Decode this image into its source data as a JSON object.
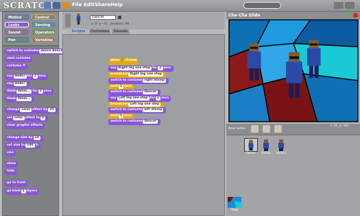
{
  "app": {
    "logo": "SCRATCH",
    "menus": [
      "File",
      "Edit",
      "Share",
      "Help"
    ]
  },
  "categories": [
    {
      "label": "Motion",
      "color": "#4a6cd4"
    },
    {
      "label": "Control",
      "color": "#e1a91a"
    },
    {
      "label": "Looks",
      "color": "#8a55d7"
    },
    {
      "label": "Sensing",
      "color": "#2ca5e2"
    },
    {
      "label": "Sound",
      "color": "#bb42c3"
    },
    {
      "label": "Operators",
      "color": "#5cb712"
    },
    {
      "label": "Pen",
      "color": "#0e9a6c"
    },
    {
      "label": "Variables",
      "color": "#ee7d16"
    }
  ],
  "palette": {
    "switch_costume": "switch to costume",
    "switch_costume_val": "dance dance",
    "next_costume": "next costume",
    "costume_num": "costume #",
    "say_for": "say",
    "say_for_val": "Hello!",
    "say_for_for": "for",
    "say_for_secs": "2",
    "say_for_unit": "secs",
    "say": "say",
    "say_val": "Hello!",
    "think_for": "think",
    "think_for_val": "Hmm...",
    "think_for_for": "for",
    "think_for_secs": "2",
    "think_for_unit": "secs",
    "think": "think",
    "think_val": "Hmm...",
    "change_effect": "change",
    "change_effect_name": "color",
    "change_effect_by": "effect by",
    "change_effect_val": "25",
    "set_effect": "set",
    "set_effect_name": "color",
    "set_effect_to": "effect to",
    "set_effect_val": "0",
    "clear_effects": "clear graphic effects",
    "change_size": "change size by",
    "change_size_val": "10",
    "set_size": "set size to",
    "set_size_val": "100",
    "set_size_unit": "%",
    "size": "size",
    "show": "show",
    "hide": "hide",
    "go_front": "go to front",
    "go_back": "go back",
    "go_back_val": "1",
    "go_back_unit": "layers"
  },
  "sprite": {
    "name": "Dancer",
    "x_label": "x: 0",
    "y_label": "y: -41",
    "direction": "direction: 90"
  },
  "tabs": [
    "Scripts",
    "Costumes",
    "Sounds"
  ],
  "script": {
    "hat": "when",
    "hat2": "clicked",
    "say1": "say",
    "say1_val": "Right leg one step",
    "say1_for": "for",
    "say1_secs": "1",
    "say1_unit": "secs",
    "broadcast1": "broadcast",
    "broadcast1_val": "Right leg one step",
    "switch1": "switch to costume",
    "switch1_val": "right stomp",
    "wait1": "wait",
    "wait1_val": "1",
    "wait1_unit": "secs",
    "switch2": "switch to costume",
    "switch2_val": "Dancer",
    "say2": "say",
    "say2_val": "Left leg one step",
    "say2_for": "for",
    "say2_secs": "1",
    "say2_unit": "secs",
    "broadcast2": "broadcast",
    "broadcast2_val": "Left leg one step",
    "switch3": "switch to costume",
    "switch3_val": "left stomp",
    "wait2": "wait",
    "wait2_val": "1",
    "wait2_unit": "secs",
    "switch4": "switch to costume",
    "switch4_val": "Dancer"
  },
  "stage": {
    "title": "Cha Cha Slide",
    "coords_x": "x: 41",
    "coords_y": "y: -161"
  },
  "new_sprite_label": "New sprite:",
  "sprites": [
    "Dancer",
    "Sprite2",
    "Sprite3"
  ],
  "stage_thumb_label": "Stage"
}
